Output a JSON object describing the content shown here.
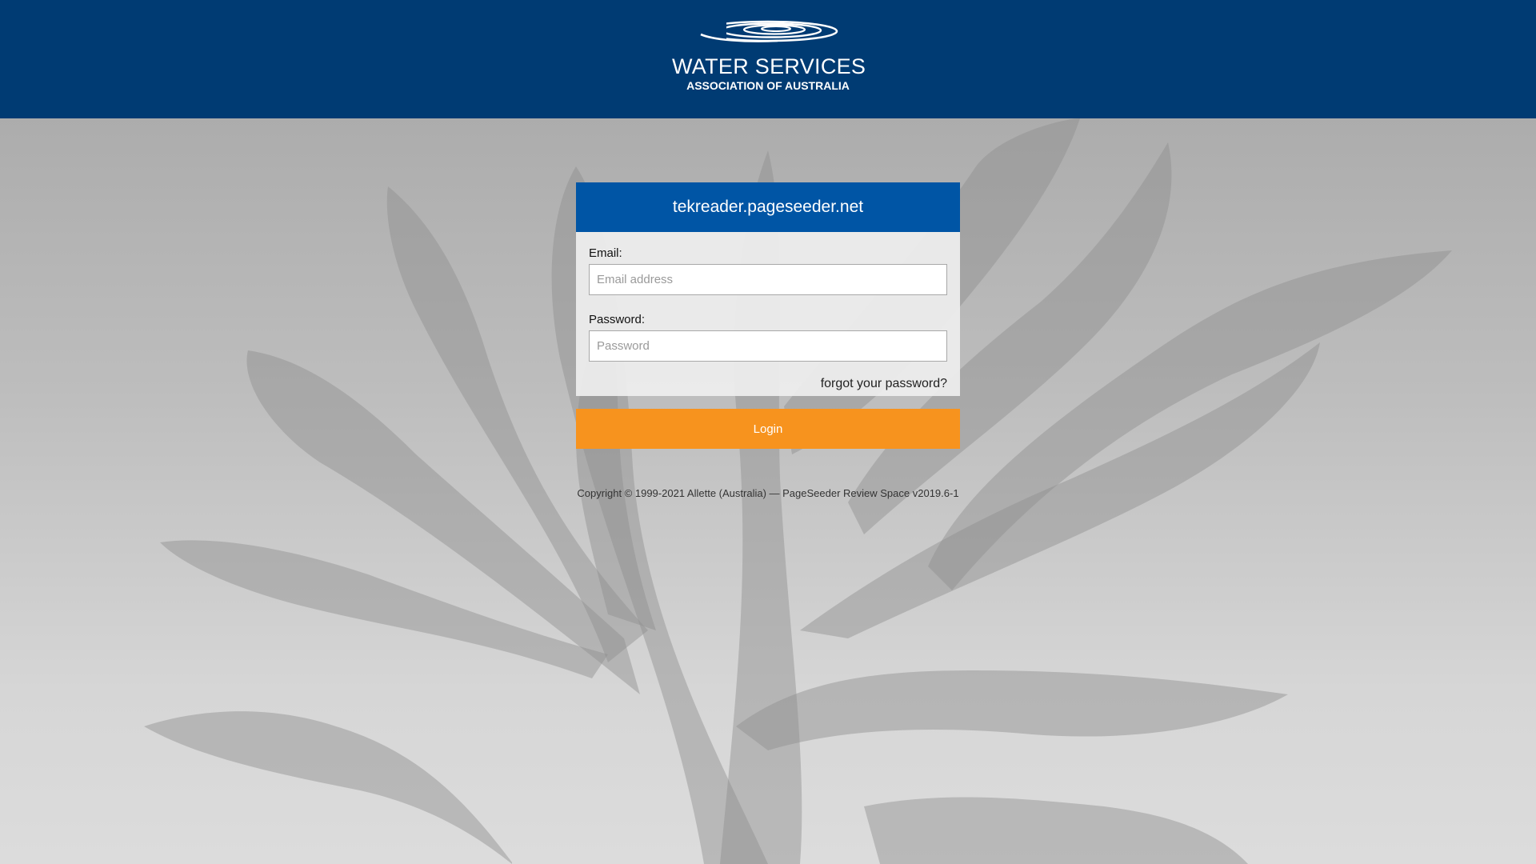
{
  "brand": {
    "line1": "WATER SERVICES",
    "line2": "ASSOCIATION OF AUSTRALIA",
    "header_color": "#003b73",
    "logo_icon": "ripple-logo-icon"
  },
  "login": {
    "site_title": "tekreader.pageseeder.net",
    "email_label": "Email:",
    "email_placeholder": "Email address",
    "email_value": "",
    "password_label": "Password:",
    "password_placeholder": "Password",
    "password_value": "",
    "forgot_label": "forgot your password?",
    "login_label": "Login",
    "title_bar_color": "#0055a5",
    "button_color": "#f7931e"
  },
  "footer": {
    "copyright": "Copyright © 1999-2021 Allette (Australia) — PageSeeder Review Space v2019.6-1"
  }
}
